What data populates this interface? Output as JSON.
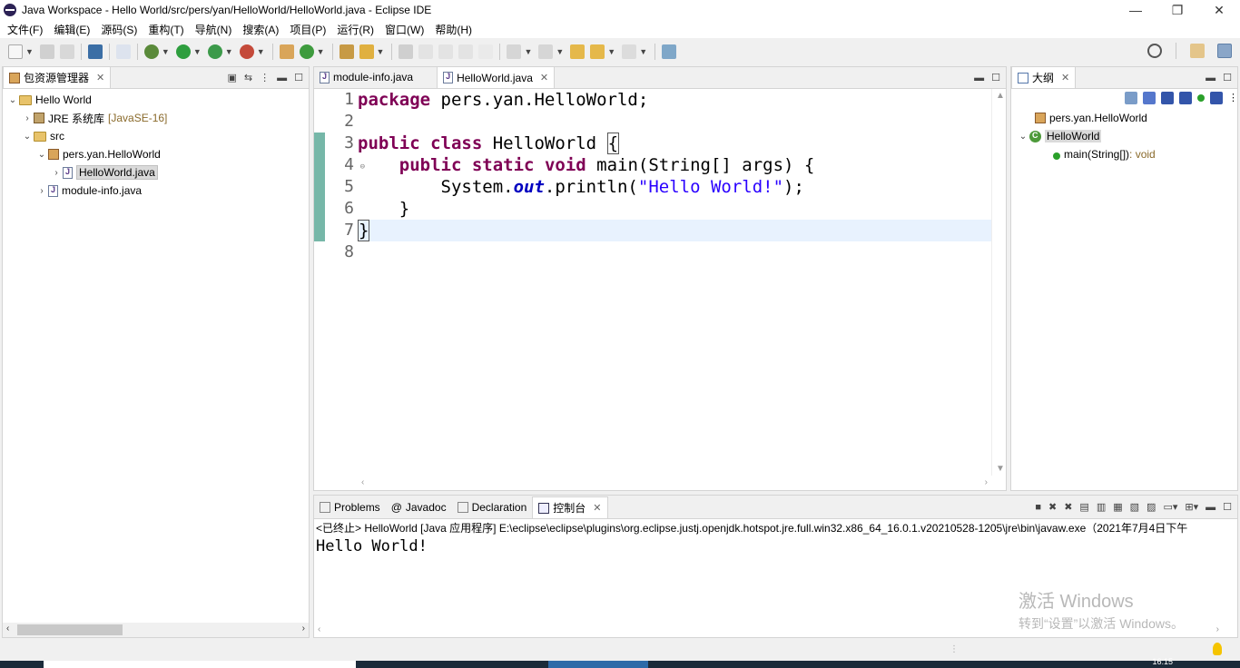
{
  "window": {
    "title": "Java Workspace - Hello World/src/pers/yan/HelloWorld/HelloWorld.java - Eclipse IDE",
    "minimize": "—",
    "restore": "❐",
    "close": "✕"
  },
  "menu": [
    "文件(F)",
    "编辑(E)",
    "源码(S)",
    "重构(T)",
    "导航(N)",
    "搜索(A)",
    "项目(P)",
    "运行(R)",
    "窗口(W)",
    "帮助(H)"
  ],
  "package_explorer": {
    "tab_label": "包资源管理器",
    "tree": [
      {
        "label": "Hello World",
        "decoration": "",
        "icon": "project-icon",
        "twisty": "expanded"
      },
      {
        "label": "JRE 系统库",
        "decoration": "[JavaSE-16]",
        "icon": "library-icon",
        "twisty": "collapsed"
      },
      {
        "label": "src",
        "decoration": "",
        "icon": "source-folder-icon",
        "twisty": "expanded"
      },
      {
        "label": "pers.yan.HelloWorld",
        "decoration": "",
        "icon": "package-icon",
        "twisty": "expanded"
      },
      {
        "label": "HelloWorld.java",
        "decoration": "",
        "icon": "java-file-icon",
        "twisty": "collapsed"
      },
      {
        "label": "module-info.java",
        "decoration": "",
        "icon": "java-file-icon",
        "twisty": "collapsed"
      }
    ]
  },
  "editor": {
    "tabs": [
      {
        "label": "module-info.java",
        "active": false
      },
      {
        "label": "HelloWorld.java",
        "active": true
      }
    ],
    "line_numbers": [
      "1",
      "2",
      "3",
      "4",
      "5",
      "6",
      "7",
      "8"
    ],
    "code": {
      "l1_kw": "package",
      "l1_rest": " pers.yan.HelloWorld;",
      "l3_kw1": "public",
      "l3_kw2": "class",
      "l3_name": " HelloWorld ",
      "l3_brace": "{",
      "l4_kw1": "public",
      "l4_kw2": "static",
      "l4_kw3": "void",
      "l4_rest": " main(String[] args) {",
      "l5_a": "System.",
      "l5_field": "out",
      "l5_b": ".println(",
      "l5_str": "\"Hello World!\"",
      "l5_c": ");",
      "l6": "}",
      "l7": "}"
    }
  },
  "outline": {
    "tab_label": "大纲",
    "items": [
      {
        "label": "pers.yan.HelloWorld",
        "type": ""
      },
      {
        "label": "HelloWorld",
        "type": ""
      },
      {
        "label": "main(String[])",
        "type": " : void"
      }
    ]
  },
  "bottom_tabs": [
    {
      "label": "Problems"
    },
    {
      "label": "Javadoc"
    },
    {
      "label": "Declaration"
    },
    {
      "label": "控制台"
    }
  ],
  "console": {
    "header": "<已终止> HelloWorld [Java 应用程序] E:\\eclipse\\eclipse\\plugins\\org.eclipse.justj.openjdk.hotspot.jre.full.win32.x86_64_16.0.1.v20210528-1205\\jre\\bin\\javaw.exe（2021年7月4日下午",
    "output": "Hello World!"
  },
  "watermark": {
    "line1": "激活 Windows",
    "line2": "转到“设置”以激活 Windows。"
  },
  "taskbar": {
    "clock": "16:15"
  }
}
